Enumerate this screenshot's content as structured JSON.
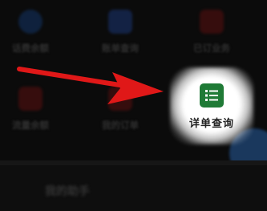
{
  "menu": {
    "items": [
      {
        "label": "话费余额",
        "icon": "balance-icon"
      },
      {
        "label": "账单查询",
        "icon": "bill-query-icon"
      },
      {
        "label": "已订业务",
        "icon": "subscribed-services-icon"
      },
      {
        "label": "流量余额",
        "icon": "data-balance-icon"
      },
      {
        "label": "我的订单",
        "icon": "my-orders-icon"
      }
    ],
    "highlighted": {
      "label": "详单查询",
      "icon": "detail-list-icon"
    }
  },
  "section": {
    "title": "我的助手"
  },
  "colors": {
    "arrow": "#e01818",
    "highlight_icon": "#1f7a36",
    "fab": "#1c3d66"
  }
}
